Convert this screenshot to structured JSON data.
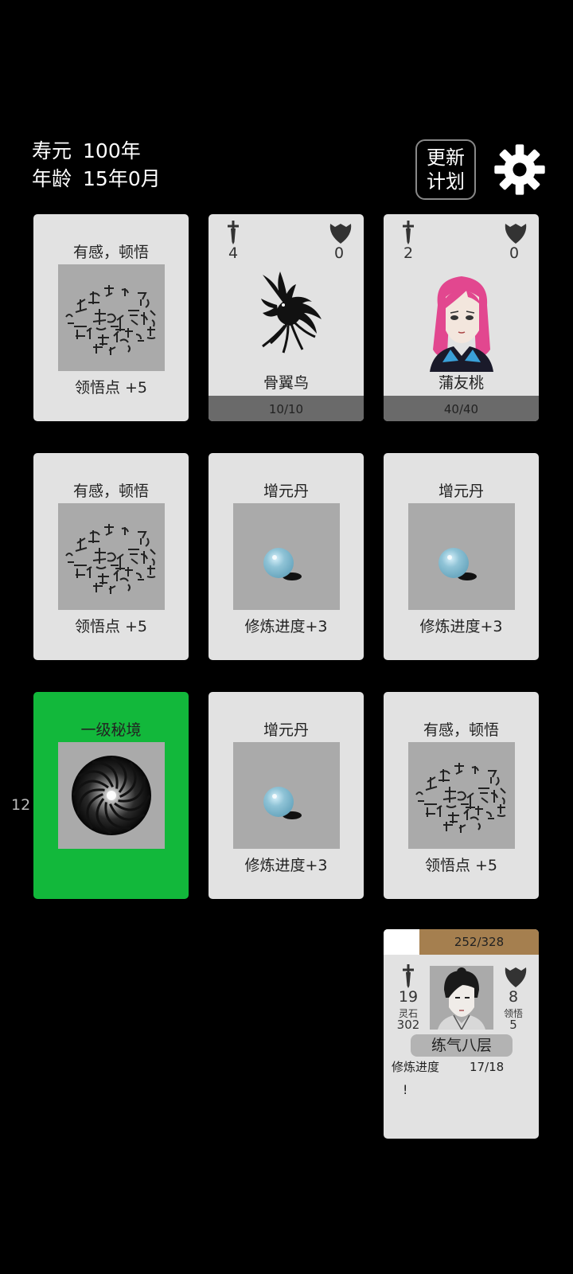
{
  "header": {
    "lifespan_label": "寿元",
    "lifespan_value": "100年",
    "age_label": "年龄",
    "age_value": "15年0月",
    "update_button": [
      "更新",
      "计划"
    ]
  },
  "cards": [
    {
      "title": "有感，顿悟",
      "caption": "领悟点  +5",
      "image": "enlightenment-calligraphy"
    },
    {
      "name": "骨翼鸟",
      "attack": "4",
      "defense": "0",
      "hp": "10/10",
      "image": "bone-wing-bird"
    },
    {
      "name": "蒲友桃",
      "attack": "2",
      "defense": "0",
      "hp": "40/40",
      "image": "pink-hair-girl"
    },
    {
      "title": "有感，顿悟",
      "caption": "领悟点  +5",
      "image": "enlightenment-calligraphy"
    },
    {
      "title": "增元丹",
      "caption": "修炼进度+3",
      "image": "blue-pill"
    },
    {
      "title": "增元丹",
      "caption": "修炼进度+3",
      "image": "blue-pill"
    },
    {
      "title": "一级秘境",
      "image": "vortex",
      "highlight_color": "#12b83b"
    },
    {
      "title": "增元丹",
      "caption": "修炼进度+3",
      "image": "blue-pill"
    },
    {
      "title": "有感，顿悟",
      "caption": "领悟点  +5",
      "image": "enlightenment-calligraphy"
    }
  ],
  "side_number": "12",
  "player": {
    "hp": "252/328",
    "hp_fraction": 0.77,
    "attack": "19",
    "spirit_stone_label": "灵石",
    "spirit_stone": "302",
    "defense": "8",
    "comprehension_label": "领悟",
    "comprehension": "5",
    "realm": "练气八层",
    "progress_label": "修炼进度",
    "progress_value": "17/18",
    "alert": "!"
  }
}
